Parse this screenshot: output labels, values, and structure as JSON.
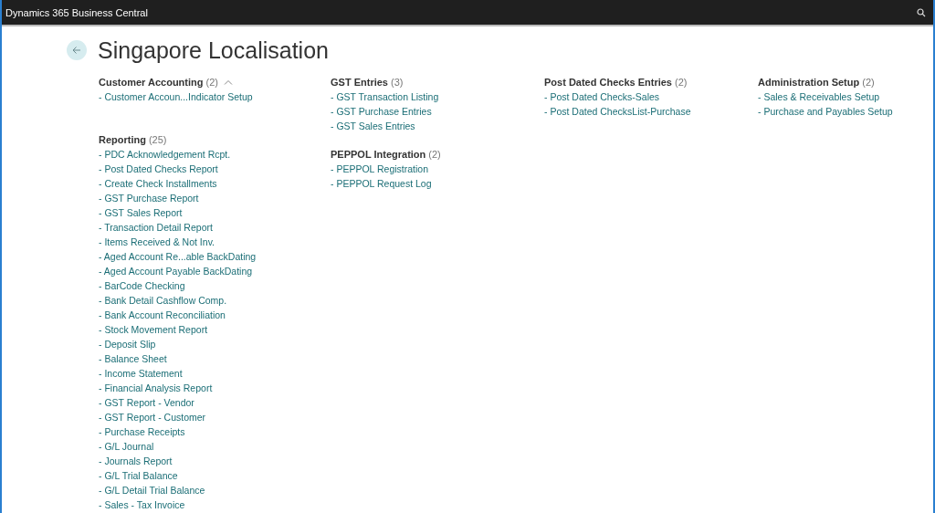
{
  "app_bar": {
    "title": "Dynamics 365 Business Central"
  },
  "page": {
    "title": "Singapore Localisation"
  },
  "columns": [
    {
      "groups": [
        {
          "title": "Customer Accounting",
          "count": "(2)",
          "hovered": true,
          "items": [
            "- Customer Accoun...Indicator Setup"
          ]
        },
        {
          "title": "Reporting",
          "count": "(25)",
          "hovered": false,
          "items": [
            "- PDC Acknowledgement Rcpt.",
            "- Post Dated Checks Report",
            "- Create Check Installments",
            "- GST Purchase Report",
            "- GST Sales Report",
            "- Transaction Detail Report",
            "- Items Received & Not Inv.",
            "- Aged Account Re...able BackDating",
            "- Aged Account Payable BackDating",
            "- BarCode Checking",
            "- Bank Detail Cashflow Comp.",
            "- Bank Account Reconciliation",
            "- Stock Movement Report",
            "- Deposit Slip",
            "- Balance Sheet",
            "- Income Statement",
            "- Financial Analysis Report",
            "- GST Report - Vendor",
            "- GST Report - Customer",
            "- Purchase Receipts",
            "- G/L Journal",
            "- Journals Report",
            "- G/L Trial Balance",
            "- G/L Detail Trial Balance",
            "- Sales - Tax Invoice"
          ]
        }
      ]
    },
    {
      "groups": [
        {
          "title": "GST Entries",
          "count": "(3)",
          "hovered": false,
          "items": [
            "- GST Transaction Listing",
            "- GST Purchase Entries",
            "- GST Sales Entries"
          ]
        },
        {
          "title": "PEPPOL Integration",
          "count": "(2)",
          "hovered": false,
          "items": [
            "- PEPPOL Registration",
            "- PEPPOL Request Log"
          ]
        }
      ]
    },
    {
      "groups": [
        {
          "title": "Post Dated Checks Entries",
          "count": "(2)",
          "hovered": false,
          "items": [
            "- Post Dated Checks-Sales",
            "- Post Dated ChecksList-Purchase"
          ]
        }
      ]
    },
    {
      "groups": [
        {
          "title": "Administration Setup",
          "count": "(2)",
          "hovered": false,
          "items": [
            "- Sales & Receivables Setup",
            "- Purchase and Payables Setup"
          ]
        }
      ]
    }
  ]
}
